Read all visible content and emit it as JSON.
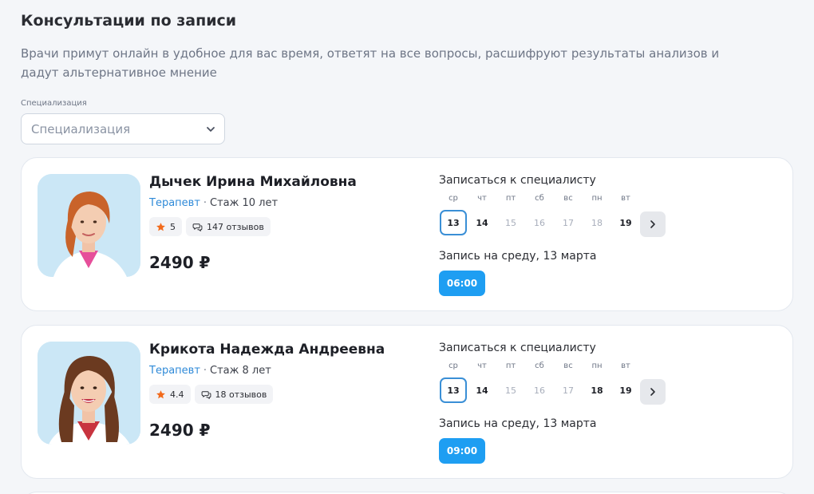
{
  "header": {
    "title": "Консультации по записи",
    "subtitle": "Врачи примут онлайн в удобное для вас время, ответят на все вопросы, расшифруют результаты анализов и дадут альтернативное мнение"
  },
  "filter": {
    "label": "Специализация",
    "placeholder": "Специализация"
  },
  "colors": {
    "accent": "#1e9ef2",
    "link": "#2f8ad8",
    "star": "#f26a1b"
  },
  "doctors": [
    {
      "name": "Дычек Ирина Михайловна",
      "specialty": "Терапевт",
      "experience": "Стаж 10 лет",
      "rating": "5",
      "reviews": "147 отзывов",
      "price": "2490 ₽",
      "schedule_title": "Записаться к специалисту",
      "days": [
        {
          "dow": "ср",
          "num": "13"
        },
        {
          "dow": "чт",
          "num": "14"
        },
        {
          "dow": "пт",
          "num": "15"
        },
        {
          "dow": "сб",
          "num": "16"
        },
        {
          "dow": "вс",
          "num": "17"
        },
        {
          "dow": "пн",
          "num": "18"
        },
        {
          "dow": "вт",
          "num": "19"
        }
      ],
      "slot_title": "Запись на среду, 13 марта",
      "slot": "06:00"
    },
    {
      "name": "Крикота Надежда Андреевна",
      "specialty": "Терапевт",
      "experience": "Стаж 8 лет",
      "rating": "4.4",
      "reviews": "18 отзывов",
      "price": "2490 ₽",
      "schedule_title": "Записаться к специалисту",
      "days": [
        {
          "dow": "ср",
          "num": "13"
        },
        {
          "dow": "чт",
          "num": "14"
        },
        {
          "dow": "пт",
          "num": "15"
        },
        {
          "dow": "сб",
          "num": "16"
        },
        {
          "dow": "вс",
          "num": "17"
        },
        {
          "dow": "пн",
          "num": "18"
        },
        {
          "dow": "вт",
          "num": "19"
        }
      ],
      "slot_title": "Запись на среду, 13 марта",
      "slot": "09:00"
    }
  ]
}
